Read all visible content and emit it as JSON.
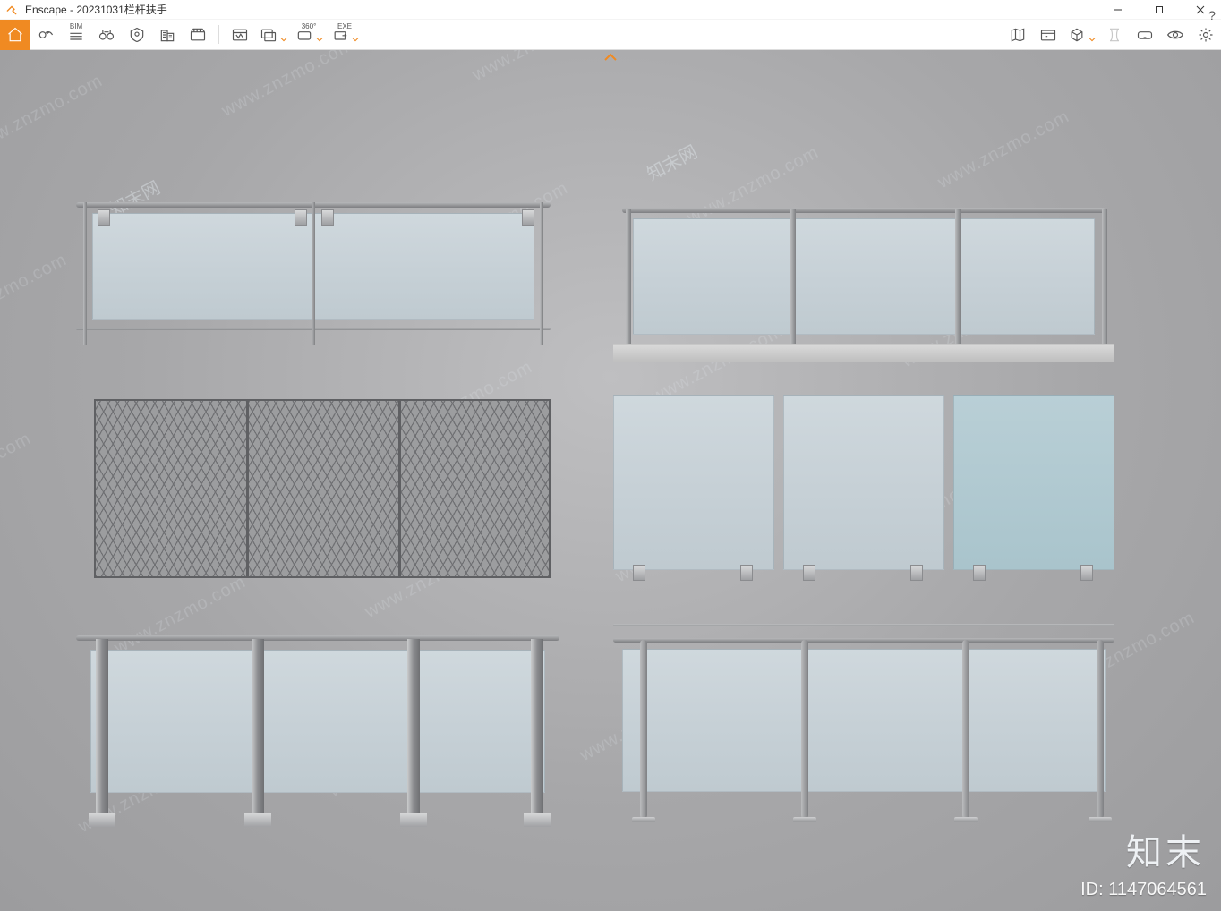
{
  "window": {
    "app_name": "Enscape",
    "title_sep": " - ",
    "document": "20231031栏杆扶手",
    "controls": {
      "minimize": "minimize",
      "maximize": "maximize",
      "close": "close"
    }
  },
  "toolbar": {
    "home": "home",
    "items_left": [
      {
        "name": "views-icon",
        "hint": "Manage Views"
      },
      {
        "name": "bim-icon",
        "hint": "BIM Mode",
        "badge": "BIM"
      },
      {
        "name": "binoculars-icon",
        "hint": "Walk / Fly"
      },
      {
        "name": "safe-frame-icon",
        "hint": "Safe Frame"
      },
      {
        "name": "site-context-icon",
        "hint": "Site Context"
      },
      {
        "name": "video-path-icon",
        "hint": "Video Path"
      }
    ],
    "items_export": [
      {
        "name": "screenshot-icon",
        "hint": "Screenshot"
      },
      {
        "name": "batch-render-icon",
        "hint": "Batch Rendering",
        "dropdown": true
      },
      {
        "name": "mono-panorama-icon",
        "hint": "Panorama 360°",
        "badge": "360°",
        "dropdown": true
      },
      {
        "name": "exe-export-icon",
        "hint": "Standalone EXE",
        "badge": "EXE",
        "dropdown": true
      }
    ],
    "items_right": [
      {
        "name": "minimap-icon",
        "hint": "Mini Map"
      },
      {
        "name": "asset-library-icon",
        "hint": "Asset Library"
      },
      {
        "name": "orbit-cube-icon",
        "hint": "Orbit",
        "dropdown": true
      },
      {
        "name": "collab-icon",
        "hint": "Collaboration",
        "disabled": true
      },
      {
        "name": "vr-headset-icon",
        "hint": "VR Headset"
      },
      {
        "name": "visual-settings-icon",
        "hint": "Visual Settings"
      },
      {
        "name": "settings-gear-icon",
        "hint": "Settings"
      },
      {
        "name": "help-icon",
        "hint": "Help"
      }
    ]
  },
  "viewport": {
    "watermark_text": "www.znzmo.com",
    "watermark_cn": "知末网",
    "brand_overlay": "知末",
    "asset_id_label": "ID: ",
    "asset_id": "1147064561"
  },
  "railings": [
    {
      "id": "r1",
      "type": "glass-double-rail",
      "col": "left",
      "row": 1
    },
    {
      "id": "r2",
      "type": "glass-post-on-slab",
      "col": "right",
      "row": 1
    },
    {
      "id": "r3",
      "type": "expanded-metal-mesh",
      "col": "left",
      "row": 2
    },
    {
      "id": "r4",
      "type": "frameless-glass-clips",
      "col": "right",
      "row": 2
    },
    {
      "id": "r5",
      "type": "glass-square-baluster",
      "col": "left",
      "row": 3
    },
    {
      "id": "r6",
      "type": "glass-round-baluster",
      "col": "right",
      "row": 3
    }
  ]
}
